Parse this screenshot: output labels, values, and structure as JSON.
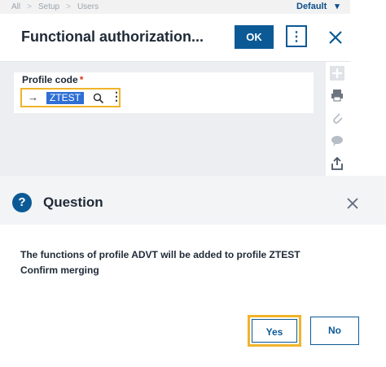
{
  "breadcrumb": {
    "items": [
      "All",
      "Setup",
      "Users"
    ],
    "profile": "Default"
  },
  "header": {
    "title": "Functional authorization...",
    "ok_label": "OK"
  },
  "field": {
    "label": "Profile code",
    "required_mark": "*",
    "value": "ZTEST",
    "arrow": "→"
  },
  "rail_icons": [
    "plus-icon",
    "printer-icon",
    "paperclip-icon",
    "comment-icon",
    "share-icon"
  ],
  "dialog": {
    "title": "Question",
    "icon": "?",
    "message_line1": "The functions of profile ADVT will be added to profile ZTEST",
    "message_line2": "Confirm merging",
    "yes_label": "Yes",
    "no_label": "No"
  },
  "colors": {
    "accent": "#0b5a96",
    "focus": "#f0b429",
    "required": "#d9381e"
  }
}
